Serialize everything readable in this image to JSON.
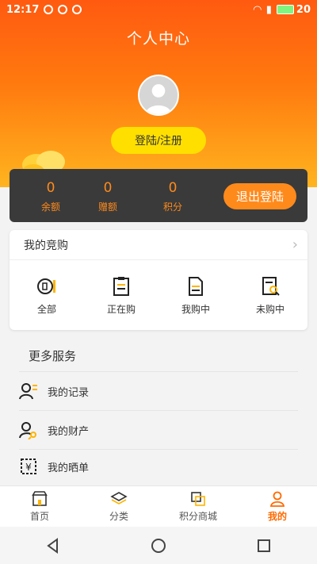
{
  "statusbar": {
    "time": "12:17",
    "battery": "20"
  },
  "header": {
    "title": "个人中心",
    "login_label": "登陆/注册"
  },
  "account": {
    "balance_value": "0",
    "balance_label": "余额",
    "gift_value": "0",
    "gift_label": "赠额",
    "points_value": "0",
    "points_label": "积分",
    "logout_label": "退出登陆"
  },
  "my_bids": {
    "title": "我的竞购",
    "items": [
      {
        "label": "全部",
        "icon": "coin-icon"
      },
      {
        "label": "正在购",
        "icon": "clipboard-icon"
      },
      {
        "label": "我购中",
        "icon": "document-icon"
      },
      {
        "label": "未购中",
        "icon": "search-document-icon"
      }
    ]
  },
  "services": {
    "title": "更多服务",
    "items": [
      {
        "label": "我的记录",
        "icon": "user-list-icon"
      },
      {
        "label": "我的财产",
        "icon": "user-key-icon"
      },
      {
        "label": "我的晒单",
        "icon": "yuan-receipt-icon"
      }
    ]
  },
  "tabbar": {
    "items": [
      {
        "label": "首页",
        "icon": "shop-icon"
      },
      {
        "label": "分类",
        "icon": "layers-icon"
      },
      {
        "label": "积分商城",
        "icon": "exchange-icon"
      },
      {
        "label": "我的",
        "icon": "user-icon",
        "active": true
      }
    ]
  },
  "colors": {
    "header_top": "#ff5a10",
    "header_bottom": "#ffb41f",
    "accent": "#ff8a1c",
    "login_button": "#ffdf00",
    "account_bar": "#3a3a3a",
    "active_tab": "#ff6a00"
  }
}
